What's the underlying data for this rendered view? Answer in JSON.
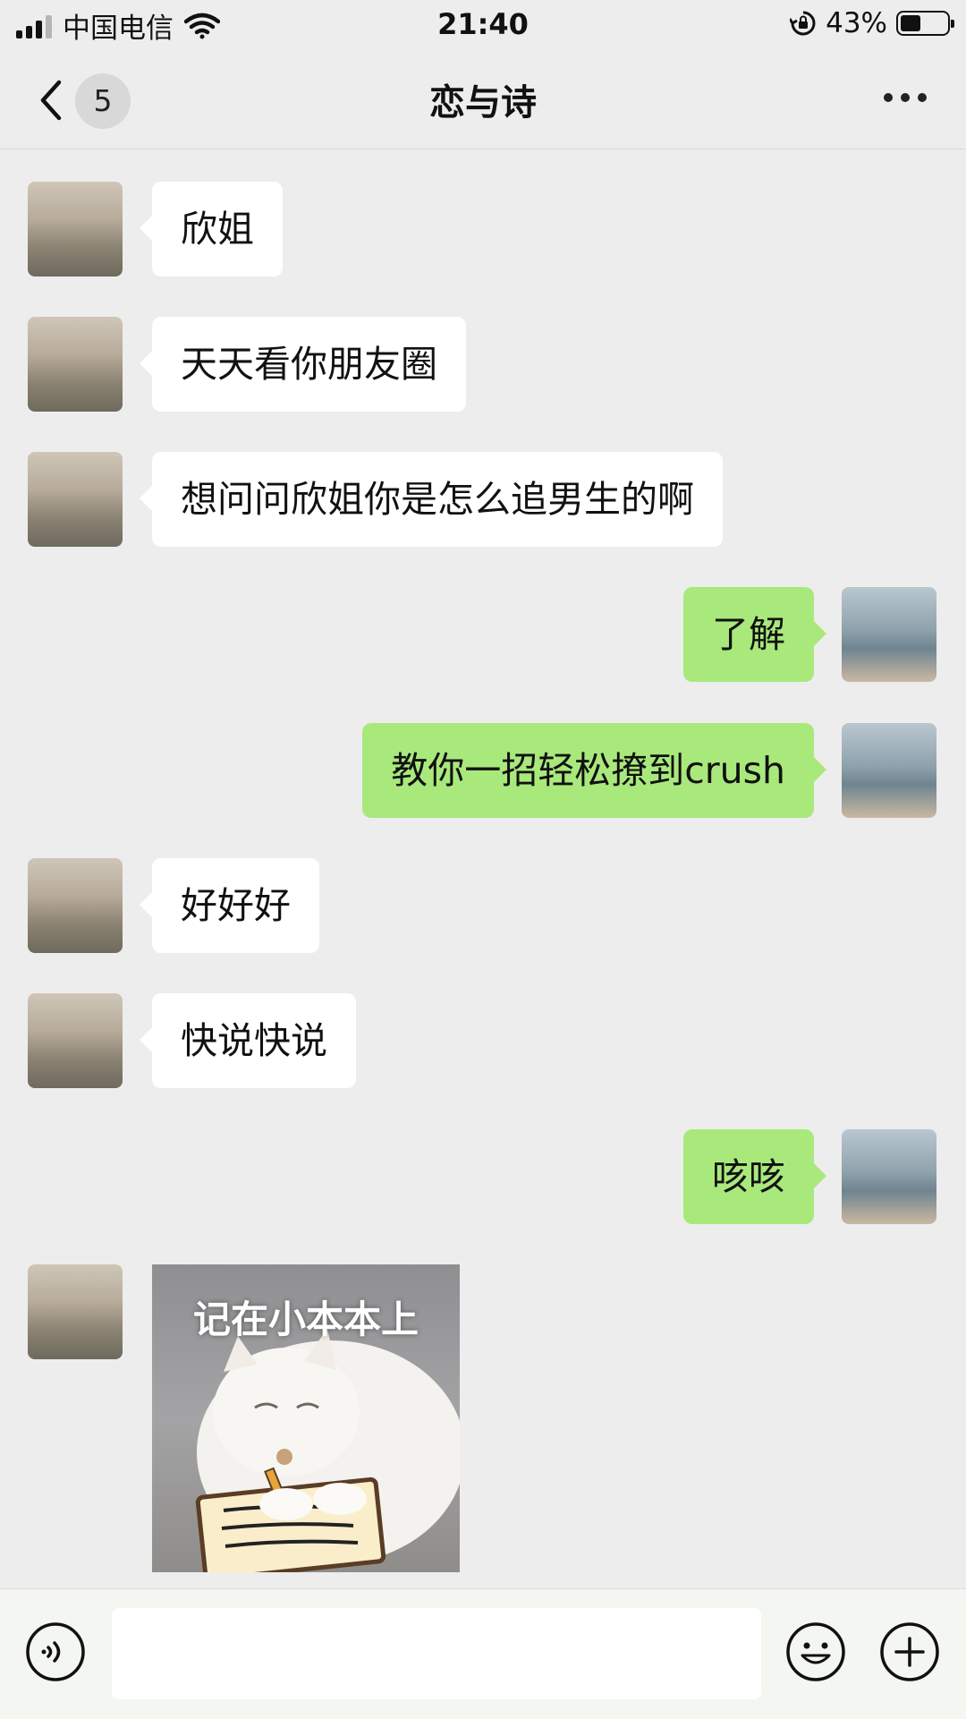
{
  "status_bar": {
    "carrier": "中国电信",
    "time": "21:40",
    "battery_text": "43%",
    "battery_level": 0.43,
    "icons": [
      "signal-icon",
      "wifi-icon",
      "rotation-lock-icon",
      "battery-icon"
    ]
  },
  "nav": {
    "unread_count": "5",
    "title": "恋与诗",
    "back_icon": "chevron-left-icon",
    "more_icon": "more-dots-icon"
  },
  "messages": [
    {
      "side": "left",
      "text": "欣姐"
    },
    {
      "side": "left",
      "text": "天天看你朋友圈"
    },
    {
      "side": "left",
      "text": "想问问欣姐你是怎么追男生的啊"
    },
    {
      "side": "right",
      "text": "了解"
    },
    {
      "side": "right",
      "text": "教你一招轻松撩到crush"
    },
    {
      "side": "left",
      "text": "好好好"
    },
    {
      "side": "left",
      "text": "快说快说"
    },
    {
      "side": "right",
      "text": "咳咳"
    },
    {
      "side": "left",
      "type": "sticker",
      "caption": "记在小本本上"
    }
  ],
  "colors": {
    "background": "#ededed",
    "incoming_bubble": "#ffffff",
    "outgoing_bubble": "#a9e97c"
  },
  "input_bar": {
    "value": "",
    "icons": [
      "voice-icon",
      "emoji-icon",
      "plus-icon"
    ]
  }
}
